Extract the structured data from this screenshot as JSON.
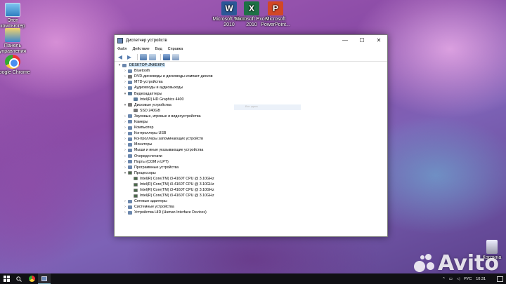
{
  "desktop": {
    "icons": [
      {
        "label": "Этот компьютер",
        "icon": "computer-icon"
      },
      {
        "label": "Панель управления",
        "icon": "control-panel-icon"
      },
      {
        "label": "Google Chrome",
        "icon": "chrome-icon"
      },
      {
        "label": "Microsoft Word 2010",
        "icon": "word-icon",
        "glyph": "W"
      },
      {
        "label": "Microsoft Excel 2010",
        "icon": "excel-icon",
        "glyph": "X"
      },
      {
        "label": "Microsoft PowerPoint...",
        "icon": "powerpoint-icon",
        "glyph": "P"
      },
      {
        "label": "Корзина",
        "icon": "recycle-bin-icon"
      }
    ]
  },
  "window": {
    "title": "Диспетчер устройств",
    "controls": {
      "minimize": "—",
      "maximize": "☐",
      "close": "✕"
    },
    "menu": [
      "Файл",
      "Действие",
      "Вид",
      "Справка"
    ],
    "toolbar": {
      "back": "◀",
      "forward": "▶"
    },
    "tree": {
      "root": "DESKTOP-JNKEKF6",
      "items": [
        {
          "label": "Bluetooth",
          "state": "collapsed"
        },
        {
          "label": "DVD-дисководы и дисководы компакт-дисков",
          "state": "collapsed"
        },
        {
          "label": "MTD-устройства",
          "state": "collapsed"
        },
        {
          "label": "Аудиовходы и аудиовыходы",
          "state": "collapsed"
        },
        {
          "label": "Видеоадаптеры",
          "state": "expanded",
          "children": [
            "Intel(R) HD Graphics 4400"
          ]
        },
        {
          "label": "Дисковые устройства",
          "state": "expanded",
          "children": [
            "SSD 240GB"
          ]
        },
        {
          "label": "Звуковые, игровые и видеоустройства",
          "state": "collapsed"
        },
        {
          "label": "Камеры",
          "state": "collapsed"
        },
        {
          "label": "Компьютер",
          "state": "collapsed"
        },
        {
          "label": "Контроллеры USB",
          "state": "collapsed"
        },
        {
          "label": "Контроллеры запоминающих устройств",
          "state": "collapsed"
        },
        {
          "label": "Мониторы",
          "state": "collapsed"
        },
        {
          "label": "Мыши и иные указывающие устройства",
          "state": "collapsed"
        },
        {
          "label": "Очереди печати",
          "state": "collapsed"
        },
        {
          "label": "Порты (COM и LPT)",
          "state": "collapsed"
        },
        {
          "label": "Программные устройства",
          "state": "collapsed"
        },
        {
          "label": "Процессоры",
          "state": "expanded",
          "children": [
            "Intel(R) Core(TM) i3-4160T CPU @ 3.10GHz",
            "Intel(R) Core(TM) i3-4160T CPU @ 3.10GHz",
            "Intel(R) Core(TM) i3-4160T CPU @ 3.10GHz",
            "Intel(R) Core(TM) i3-4160T CPU @ 3.10GHz"
          ]
        },
        {
          "label": "Сетевые адаптеры",
          "state": "collapsed"
        },
        {
          "label": "Системные устройства",
          "state": "collapsed"
        },
        {
          "label": "Устройства HID (Human Interface Devices)",
          "state": "collapsed"
        }
      ]
    },
    "ghost_tooltip": "Вот здесь"
  },
  "watermark": {
    "text": "Avito"
  },
  "taskbar": {
    "tray": {
      "language": "РУС",
      "time": "10:31"
    }
  },
  "colors": {
    "selection": "#cce4f7",
    "taskbar": "#101014",
    "window_border": "#7a7a7a"
  }
}
